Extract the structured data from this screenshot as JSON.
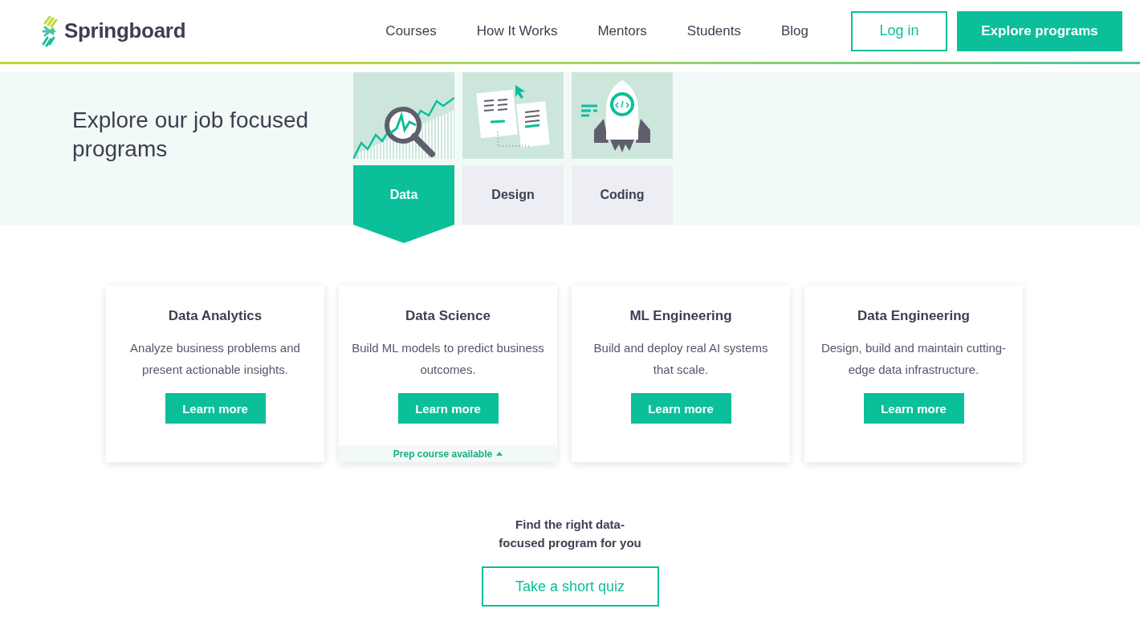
{
  "header": {
    "logo": "Springboard",
    "nav": [
      "Courses",
      "How It Works",
      "Mentors",
      "Students",
      "Blog"
    ],
    "login": "Log in",
    "cta": "Explore programs"
  },
  "hero": {
    "title": "Explore our job focused programs",
    "tracks": [
      {
        "label": "Data",
        "kind": "data",
        "selected": true
      },
      {
        "label": "Design",
        "kind": "design",
        "selected": false
      },
      {
        "label": "Coding",
        "kind": "coding",
        "selected": false
      }
    ]
  },
  "programs": [
    {
      "title": "Data Analytics",
      "description": "Analyze business problems and present actionable insights.",
      "button": "Learn more"
    },
    {
      "title": "Data Science",
      "description": "Build ML models to predict business outcomes.",
      "button": "Learn more",
      "note": "Prep course available"
    },
    {
      "title": "ML Engineering",
      "description": "Build and deploy real AI systems that scale.",
      "button": "Learn more"
    },
    {
      "title": "Data Engineering",
      "description": "Design, build and maintain cutting-edge data infrastructure.",
      "button": "Learn more"
    }
  ],
  "quiz": {
    "prompt": "Find the right data-focused program for you",
    "button": "Take a short quiz"
  }
}
